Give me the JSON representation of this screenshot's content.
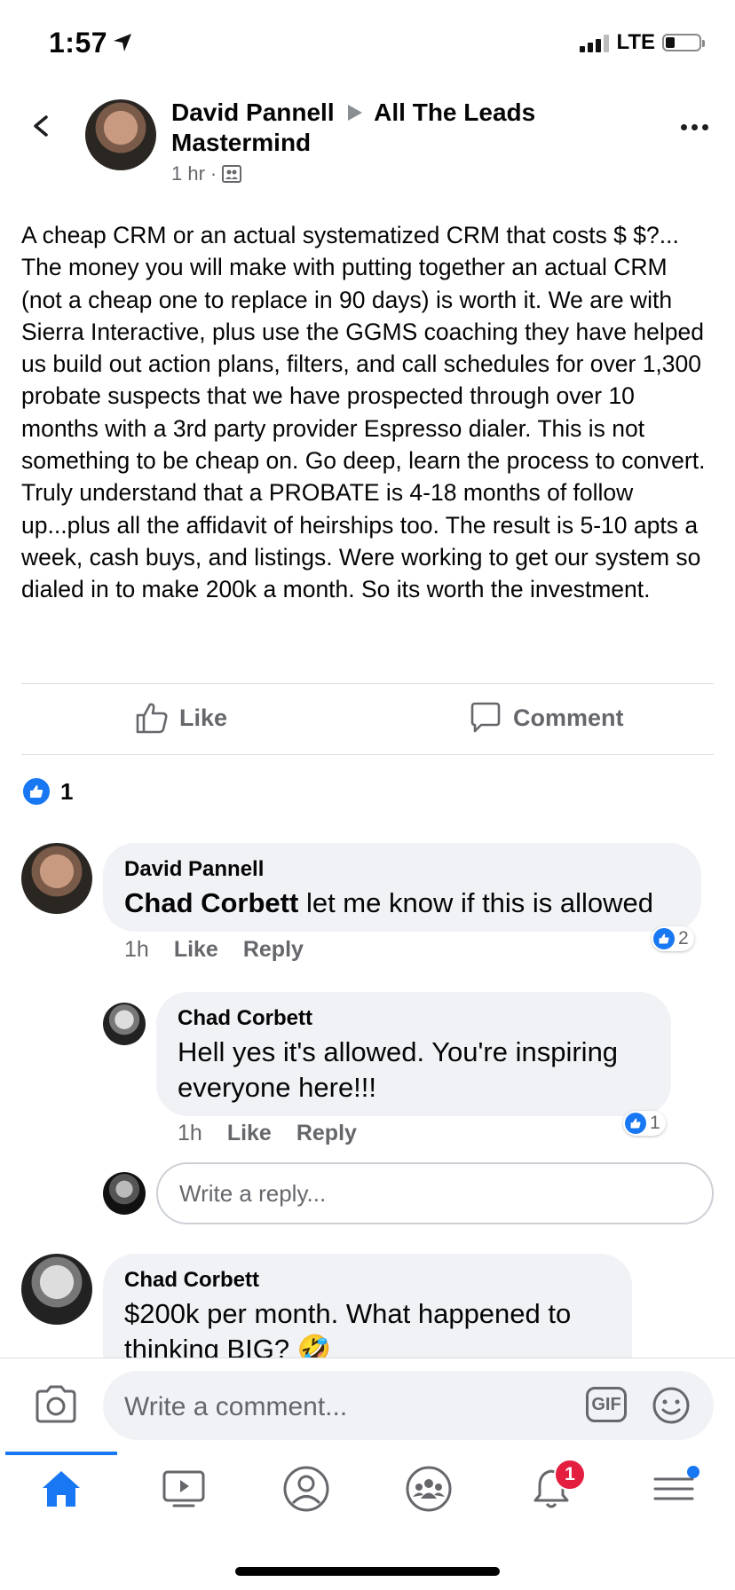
{
  "status_bar": {
    "time": "1:57",
    "network": "LTE"
  },
  "post": {
    "author": "David Pannell",
    "group": "All The Leads Mastermind",
    "time": "1 hr",
    "text": "A cheap CRM or an actual systematized CRM that costs $ $?... The money you will make with putting together an actual CRM (not a cheap one to replace in 90 days) is worth it. We are with Sierra Interactive, plus use the GGMS coaching they have helped us build out action plans, filters, and call schedules for over 1,300 probate suspects that we have prospected through over 10 months  with a 3rd party provider Espresso dialer. This is not something to be  cheap on. Go deep, learn the process to convert. Truly understand that a  PROBATE is 4-18 months of follow up...plus all the affidavit of  heirships too. The result is 5-10 apts a week, cash buys, and listings.  Were working to get our system so dialed in to make 200k a month. So its  worth the investment.",
    "like_label": "Like",
    "comment_label": "Comment",
    "reaction_count": "1"
  },
  "comments": [
    {
      "author": "David Pannell",
      "mention": "Chad Corbett",
      "text": " let me know if this is allowed",
      "time": "1h",
      "like_label": "Like",
      "reply_label": "Reply",
      "reactions": "2"
    },
    {
      "author": "Chad Corbett",
      "text": "Hell yes it's allowed.  You're inspiring everyone here!!!",
      "time": "1h",
      "like_label": "Like",
      "reply_label": "Reply",
      "reactions": "1"
    },
    {
      "author": "Chad Corbett",
      "text": "$200k per month.  What happened to thinking BIG? 🤣"
    }
  ],
  "reply_placeholder": "Write a reply...",
  "composer": {
    "placeholder": "Write a comment...",
    "gif_label": "GIF"
  },
  "tabbar": {
    "notifications_badge": "1"
  },
  "colors": {
    "accent": "#1877f2",
    "badge": "#e41e3f",
    "secondary_text": "#65676b"
  },
  "icons": [
    "back-arrow-icon",
    "more-icon",
    "group-icon",
    "like-icon",
    "comment-icon",
    "camera-icon",
    "gif-icon",
    "emoji-icon",
    "home-icon",
    "watch-icon",
    "profile-icon",
    "groups-icon",
    "bell-icon",
    "menu-icon"
  ]
}
